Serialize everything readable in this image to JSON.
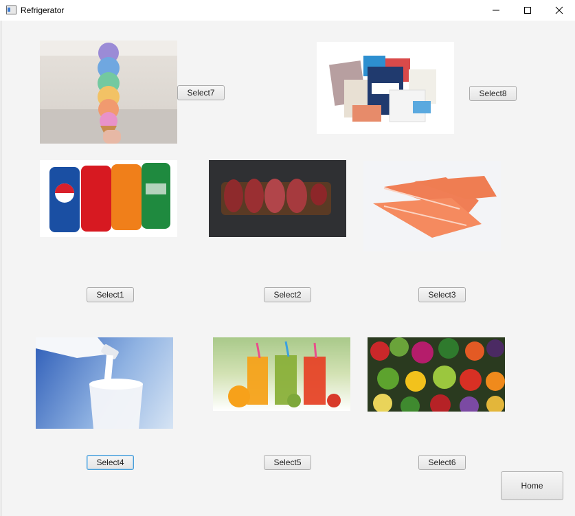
{
  "window": {
    "title": "Refrigerator",
    "controls": [
      "minimize-icon",
      "maximize-icon",
      "close-icon"
    ]
  },
  "items": [
    {
      "id": "ice-cream",
      "button": "Select7"
    },
    {
      "id": "frozen-seafood",
      "button": "Select8"
    },
    {
      "id": "soda-cans",
      "button": "Select1"
    },
    {
      "id": "raw-steaks",
      "button": "Select2"
    },
    {
      "id": "salmon-fillets",
      "button": "Select3"
    },
    {
      "id": "milk",
      "button": "Select4"
    },
    {
      "id": "juices",
      "button": "Select5"
    },
    {
      "id": "vegetables",
      "button": "Select6"
    }
  ],
  "home_button": "Home",
  "colors": {
    "accent_focus": "#4a9fd8",
    "window_bg": "#f4f4f4"
  }
}
